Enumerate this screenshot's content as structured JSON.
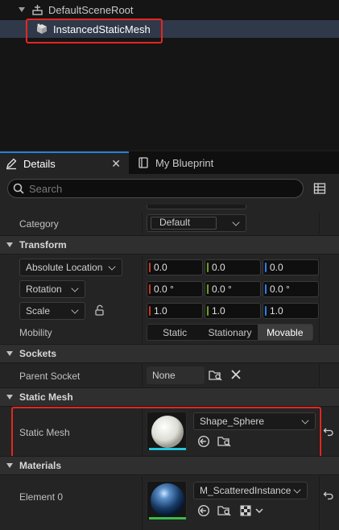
{
  "components": {
    "root": {
      "label": "DefaultSceneRoot",
      "icon": "scene-root-icon"
    },
    "selected": {
      "label": "InstancedStaticMesh",
      "icon": "instanced-mesh-icon"
    }
  },
  "tabs": [
    {
      "label": "Details",
      "icon": "pencil-icon",
      "active": true
    },
    {
      "label": "My Blueprint",
      "icon": "book-icon",
      "active": false
    }
  ],
  "search": {
    "placeholder": "Search",
    "value": ""
  },
  "details": {
    "category": {
      "label": "Category",
      "value": "Default"
    },
    "transform": {
      "title": "Transform",
      "location": {
        "label": "Absolute Location",
        "x": "0.0",
        "y": "0.0",
        "z": "0.0"
      },
      "rotation": {
        "label": "Rotation",
        "x": "0.0 °",
        "y": "0.0 °",
        "z": "0.0 °"
      },
      "scale": {
        "label": "Scale",
        "x": "1.0",
        "y": "1.0",
        "z": "1.0"
      },
      "mobility": {
        "label": "Mobility",
        "options": [
          "Static",
          "Stationary",
          "Movable"
        ],
        "selected": "Movable"
      }
    },
    "sockets": {
      "title": "Sockets",
      "parent_socket": {
        "label": "Parent Socket",
        "value": "None"
      }
    },
    "static_mesh": {
      "title": "Static Mesh",
      "mesh": {
        "label": "Static Mesh",
        "value": "Shape_Sphere"
      }
    },
    "materials": {
      "title": "Materials",
      "element0": {
        "label": "Element 0",
        "value": "M_ScatteredInstance"
      }
    }
  },
  "colors": {
    "highlight": "#e5261f",
    "selection_row": "#30394a",
    "tab_accent": "#2a7fd6",
    "axis_x": "#c23b22",
    "axis_y": "#6b9f1f",
    "axis_z": "#2f7ee6",
    "mesh_underline": "#26c6da",
    "material_underline": "#3dbb4a"
  }
}
